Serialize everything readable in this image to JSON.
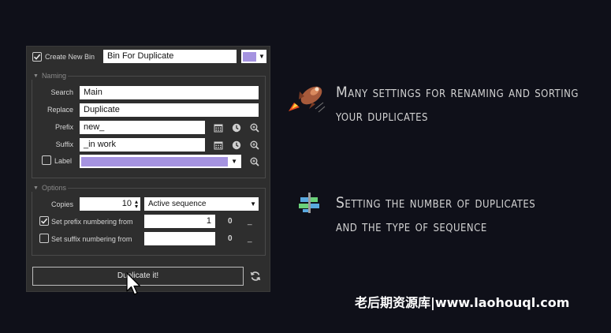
{
  "header": {
    "create_bin_checked": true,
    "create_bin_label": "Create New Bin",
    "bin_name_value": "Bin For Duplicate",
    "bin_color": "#a593e0"
  },
  "naming": {
    "title": "Naming",
    "search_label": "Search",
    "search_value": "Main",
    "replace_label": "Replace",
    "replace_value": "Duplicate",
    "prefix_label": "Prefix",
    "prefix_value": "new_",
    "suffix_label": "Suffix",
    "suffix_value": "_in work",
    "label_checkbox_label": "Label",
    "label_checked": false,
    "label_color": "#a593e0"
  },
  "options": {
    "title": "Options",
    "copies_label": "Copies",
    "copies_value": "10",
    "sequence_type_value": "Active sequence",
    "prefix_numbering_label": "Set prefix numbering from",
    "prefix_numbering_checked": true,
    "prefix_numbering_value": "1",
    "prefix_numbering_readout": "0",
    "prefix_numbering_trail": "_",
    "suffix_numbering_label": "Set suffix numbering from",
    "suffix_numbering_checked": false,
    "suffix_numbering_value": "",
    "suffix_numbering_readout": "0",
    "suffix_numbering_trail": "_"
  },
  "actions": {
    "duplicate_label": "Duplicate it!"
  },
  "promo": {
    "line1a": "Many settings for renaming and sorting",
    "line1b": "your duplicates",
    "line2a": "Setting the number of duplicates",
    "line2b": "and the type of sequence"
  },
  "watermark": "老后期资源库|www.laohouql.com",
  "icons": {
    "rocket": "rocket-icon",
    "sequence": "sequence-icon"
  }
}
